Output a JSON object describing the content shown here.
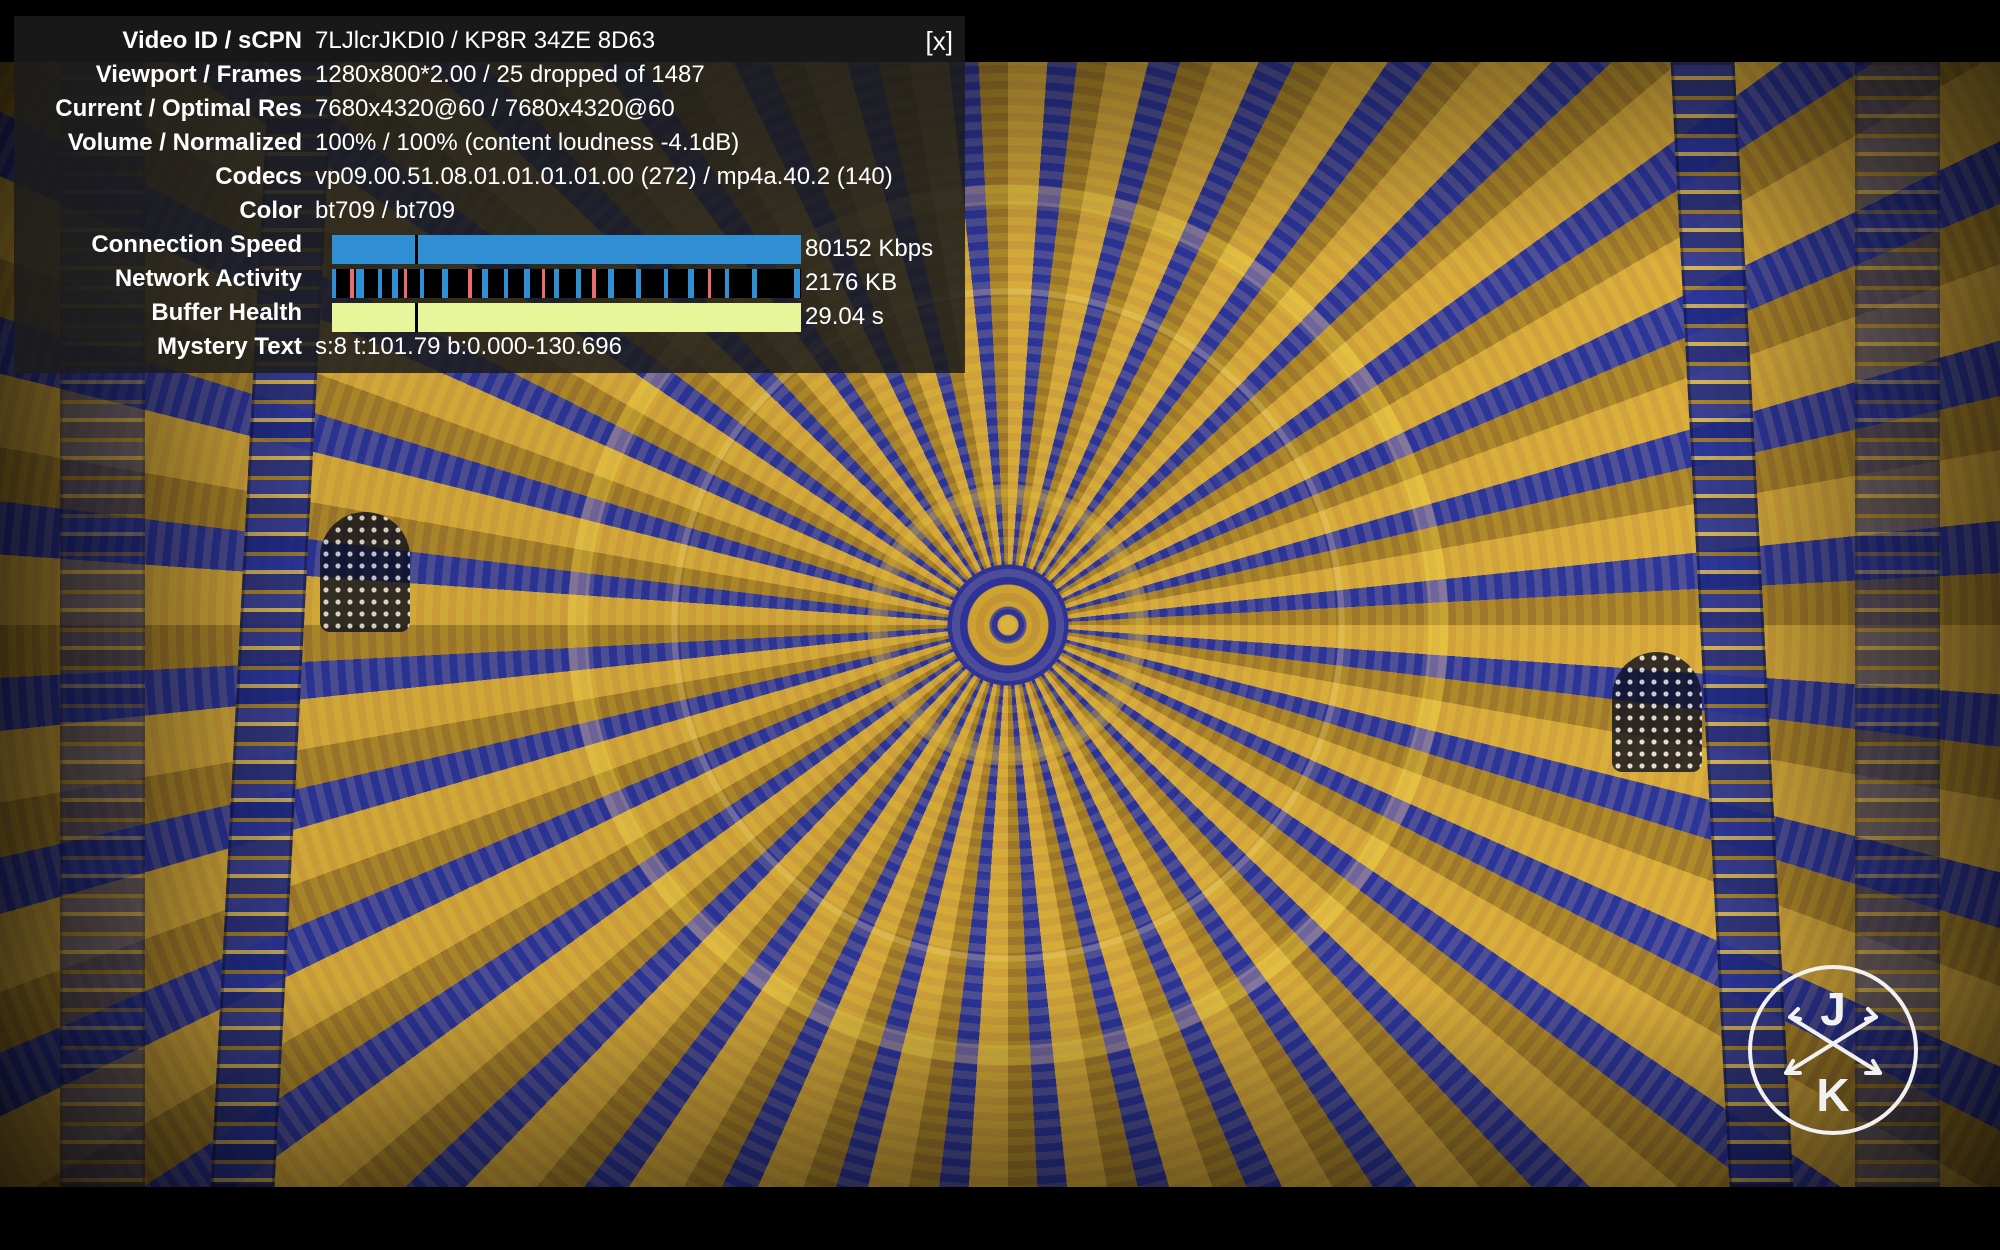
{
  "stats": {
    "close_label": "[x]",
    "rows": [
      {
        "label": "Video ID / sCPN",
        "value": "7LJlcrJKDI0 / KP8R 34ZE 8D63"
      },
      {
        "label": "Viewport / Frames",
        "value": "1280x800*2.00 / 25 dropped of 1487"
      },
      {
        "label": "Current / Optimal Res",
        "value": "7680x4320@60 / 7680x4320@60"
      },
      {
        "label": "Volume / Normalized",
        "value": "100% / 100% (content loudness -4.1dB)"
      },
      {
        "label": "Codecs",
        "value": "vp09.00.51.08.01.01.01.01.00 (272) / mp4a.40.2 (140)"
      },
      {
        "label": "Color",
        "value": "bt709 / bt709"
      },
      {
        "label": "Connection Speed",
        "value": "80152 Kbps"
      },
      {
        "label": "Network Activity",
        "value": "2176 KB"
      },
      {
        "label": "Buffer Health",
        "value": "29.04 s"
      },
      {
        "label": "Mystery Text",
        "value": "s:8 t:101.79 b:0.000-130.696"
      }
    ]
  },
  "graph_colors": {
    "connection": "#2f8fd2",
    "network_bg": "#000000",
    "network_bar": "#2f8fd2",
    "network_accent": "#ea6c6c",
    "buffer": "#e7f59b"
  },
  "logo": {
    "text_top": "J",
    "text_bottom": "K",
    "icon": "crossed-arrows-icon"
  }
}
